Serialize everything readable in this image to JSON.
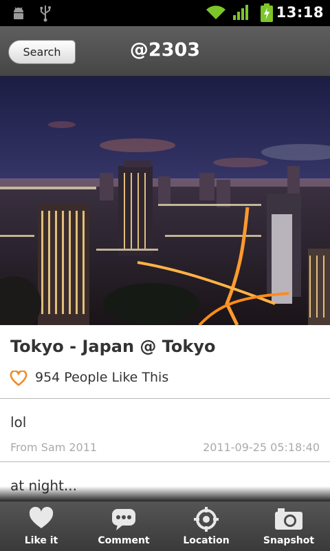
{
  "status_bar": {
    "time": "13:18",
    "icons": [
      "android-debug-icon",
      "usb-icon",
      "wifi-icon",
      "signal-icon",
      "battery-charging-icon"
    ]
  },
  "header": {
    "back_button_label": "Search",
    "title": "@2303"
  },
  "photo": {
    "subject": "city-night-skyline-image"
  },
  "post": {
    "title": "Tokyo - Japan @ Tokyo",
    "likes_text": "954 People Like This",
    "like_icon": "heart-outline-icon"
  },
  "comments": [
    {
      "text": "lol",
      "author": "From Sam 2011",
      "date": "2011-09-25 05:18:40"
    },
    {
      "text": "at night..."
    }
  ],
  "tab_bar": {
    "items": [
      {
        "label": "Like it",
        "icon": "heart-icon"
      },
      {
        "label": "Comment",
        "icon": "comment-icon"
      },
      {
        "label": "Location",
        "icon": "location-icon"
      },
      {
        "label": "Snapshot",
        "icon": "camera-icon"
      }
    ]
  },
  "colors": {
    "status_bar_bg": "#000000",
    "title_bar_bg": "#505050",
    "accent_heart": "#f08a24",
    "signal_green": "#8bc34a",
    "meta_text": "#aaaaaa"
  }
}
